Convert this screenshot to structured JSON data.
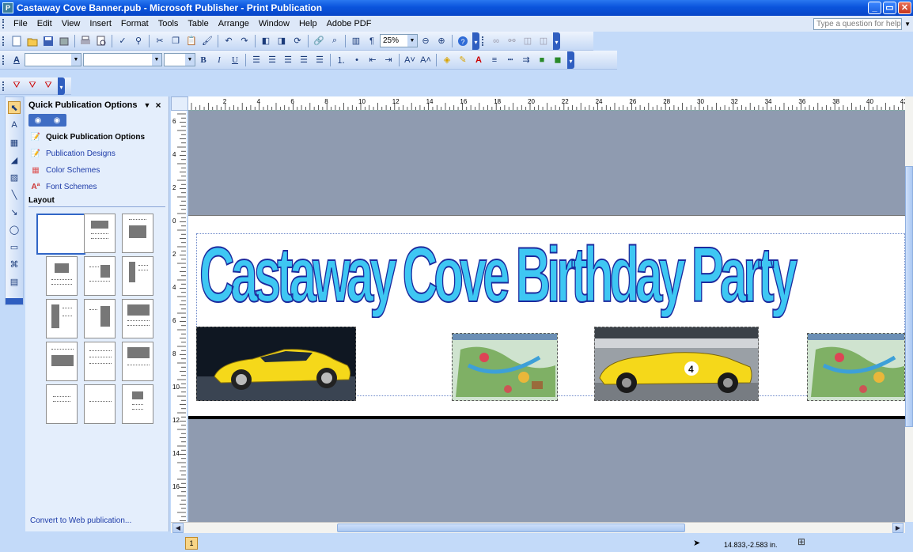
{
  "window": {
    "title": "Castaway Cove Banner.pub - Microsoft Publisher - Print Publication",
    "app_icon": "P",
    "controls": [
      "_",
      "▭",
      "✕"
    ]
  },
  "menubar": {
    "items": [
      "File",
      "Edit",
      "View",
      "Insert",
      "Format",
      "Tools",
      "Table",
      "Arrange",
      "Window",
      "Help",
      "Adobe PDF"
    ],
    "help_placeholder": "Type a question for help"
  },
  "standard_toolbar": {
    "zoom_value": "25%",
    "icons": [
      "new-icon",
      "open-icon",
      "save-icon",
      "print-icon",
      "print-preview-icon",
      "spelling-icon",
      "research-icon",
      "cut-icon",
      "copy-icon",
      "paste-icon",
      "format-painter-icon",
      "undo-icon",
      "redo-icon",
      "bring-forward-icon",
      "send-backward-icon",
      "rotate-icon",
      "zoom-in-icon",
      "zoom-out-icon",
      "help-icon"
    ]
  },
  "formatting_toolbar": {
    "style_value": "",
    "font_value": "",
    "size_value": "",
    "glyphs": {
      "bold": "B",
      "italic": "I",
      "underline": "U"
    }
  },
  "pdf_toolbar": {
    "icons": [
      "convert-pdf-icon",
      "convert-pdf-email-icon",
      "convert-pdf-review-icon"
    ]
  },
  "task_pane": {
    "title": "Quick Publication Options",
    "links": [
      {
        "label": "Quick Publication Options",
        "icon": "quick-options-icon"
      },
      {
        "label": "Publication Designs",
        "icon": "designs-icon"
      },
      {
        "label": "Color Schemes",
        "icon": "color-schemes-icon"
      },
      {
        "label": "Font Schemes",
        "icon": "font-schemes-icon"
      }
    ],
    "layout_heading": "Layout",
    "bottom_link": "Convert to Web publication..."
  },
  "rulers": {
    "horizontal_labels": [
      "2",
      "4",
      "6",
      "8",
      "10",
      "12",
      "14",
      "16",
      "18",
      "20",
      "22",
      "24",
      "26",
      "28",
      "30",
      "32",
      "34",
      "36",
      "38",
      "40",
      "42"
    ],
    "vertical_labels": [
      "6",
      "4",
      "2",
      "0",
      "2",
      "4",
      "6",
      "8",
      "10",
      "12",
      "14",
      "16"
    ]
  },
  "document": {
    "wordart_text": "Castaway Cove Birthday Party",
    "photos": [
      "yellow-corvette-photo",
      "park-map-photo",
      "racing-corvette-photo",
      "park-map-photo"
    ],
    "race_car_number": "4"
  },
  "status": {
    "page_number": "1",
    "coordinates": "14.833,-2.583 in."
  },
  "colors": {
    "titlebar": "#0a54dc",
    "wordart_fill": "#3ec7f3",
    "wordart_outline": "#1c2a9e",
    "canvas": "#8f9bb0",
    "car_yellow": "#f5d81a"
  }
}
